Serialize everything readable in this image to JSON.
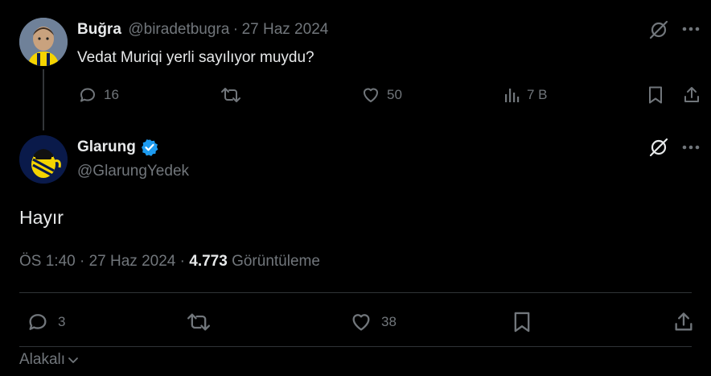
{
  "parent_tweet": {
    "author_name": "Buğra",
    "author_handle": "@biradetbugra",
    "separator": "·",
    "date": "27 Haz 2024",
    "text": "Vedat Muriqi yerli sayılıyor muydu?",
    "replies": "16",
    "likes": "50",
    "views": "7 B",
    "icons": [
      "grok-icon",
      "more-icon",
      "reply-icon",
      "retweet-icon",
      "like-icon",
      "views-icon",
      "bookmark-icon",
      "share-icon"
    ]
  },
  "main_tweet": {
    "author_name": "Glarung",
    "author_handle": "@GlarungYedek",
    "verified": true,
    "text": "Hayır",
    "time": "ÖS 1:40",
    "separator": "·",
    "date": "27 Haz 2024",
    "views_count": "4.773",
    "views_label": "Görüntüleme",
    "replies": "3",
    "likes": "38",
    "icons": [
      "grok-icon",
      "more-icon",
      "reply-icon",
      "retweet-icon",
      "like-icon",
      "bookmark-icon",
      "share-icon"
    ]
  },
  "footer": {
    "relevance_label": "Alakalı"
  },
  "colors": {
    "background": "#000000",
    "text": "#e7e9ea",
    "muted": "#71767b",
    "verified": "#1d9bf0",
    "avatar_yellow": "#f5d400",
    "avatar_navy": "#0a1a4a"
  }
}
